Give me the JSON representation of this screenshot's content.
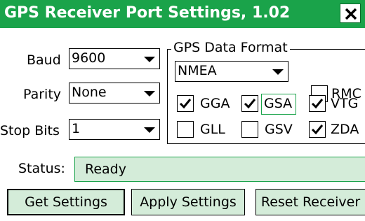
{
  "window": {
    "title": "GPS Receiver Port Settings, 1.02"
  },
  "port": {
    "baud_label": "Baud",
    "baud_value": "9600",
    "parity_label": "Parity",
    "parity_value": "None",
    "stopbits_label": "Stop Bits",
    "stopbits_value": "1"
  },
  "format": {
    "group_title": "GPS Data Format",
    "protocol_value": "NMEA",
    "sentences": [
      {
        "label": "RMC",
        "checked": false
      },
      {
        "label": "GGA",
        "checked": true
      },
      {
        "label": "GSA",
        "checked": true
      },
      {
        "label": "VTG",
        "checked": true
      },
      {
        "label": "GLL",
        "checked": false
      },
      {
        "label": "GSV",
        "checked": false
      },
      {
        "label": "ZDA",
        "checked": true
      }
    ]
  },
  "status": {
    "label": "Status:",
    "value": "Ready"
  },
  "buttons": {
    "get": "Get Settings",
    "apply": "Apply Settings",
    "reset": "Reset Receiver"
  },
  "colors": {
    "titlebar": "#1aa34a",
    "field_bg": "#d4ecd9"
  }
}
